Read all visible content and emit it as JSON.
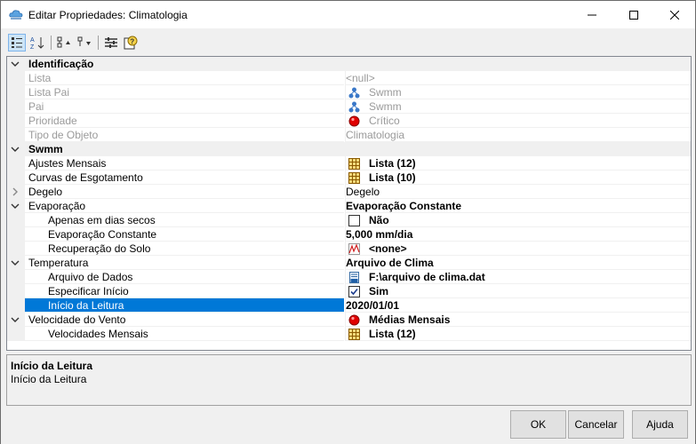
{
  "window": {
    "title": "Editar Propriedades: Climatologia",
    "controls": {
      "minimize": "minimize-icon",
      "maximize": "maximize-icon",
      "close": "close-icon"
    }
  },
  "toolbar": {
    "buttons": [
      "categorized-icon",
      "alphabetical-icon",
      "expand-all-icon",
      "collapse-all-icon",
      "properties-icon",
      "help-icon"
    ]
  },
  "grid": {
    "categories": {
      "identificacao": "Identificação",
      "swmm": "Swmm"
    },
    "rows": {
      "lista": {
        "name": "Lista",
        "value": "<null>"
      },
      "lista_pai": {
        "name": "Lista Pai",
        "value": "Swmm"
      },
      "pai": {
        "name": "Pai",
        "value": "Swmm"
      },
      "prioridade": {
        "name": "Prioridade",
        "value": "Crítico"
      },
      "tipo_objeto": {
        "name": "Tipo de Objeto",
        "value": "Climatologia"
      },
      "ajustes": {
        "name": "Ajustes Mensais",
        "value": "Lista (12)"
      },
      "curvas": {
        "name": "Curvas de Esgotamento",
        "value": "Lista (10)"
      },
      "degelo": {
        "name": "Degelo",
        "value": "Degelo"
      },
      "evaporacao": {
        "name": "Evaporação",
        "value": "Evaporação Constante"
      },
      "dias_secos": {
        "name": "Apenas em dias secos",
        "value": "Não"
      },
      "evap_constante": {
        "name": "Evaporação Constante",
        "value": "5,000 mm/dia"
      },
      "recuperacao": {
        "name": "Recuperação do Solo",
        "value": "<none>"
      },
      "temperatura": {
        "name": "Temperatura",
        "value": "Arquivo de Clima"
      },
      "arquivo": {
        "name": "Arquivo de Dados",
        "value": "F:\\arquivo de clima.dat"
      },
      "especificar": {
        "name": "Especificar Início",
        "value": "Sim"
      },
      "inicio": {
        "name": "Início da Leitura",
        "value": "2020/01/01"
      },
      "vento": {
        "name": "Velocidade do Vento",
        "value": "Médias Mensais"
      },
      "vel_mensais": {
        "name": "Velocidades Mensais",
        "value": "Lista (12)"
      }
    }
  },
  "description": {
    "title": "Início da Leitura",
    "text": "Início da Leitura"
  },
  "buttons": {
    "ok": "OK",
    "cancel": "Cancelar",
    "help": "Ajuda"
  },
  "colors": {
    "selection": "#0078d7",
    "critical": "#e00000",
    "gutter": "#f0f0f0"
  }
}
